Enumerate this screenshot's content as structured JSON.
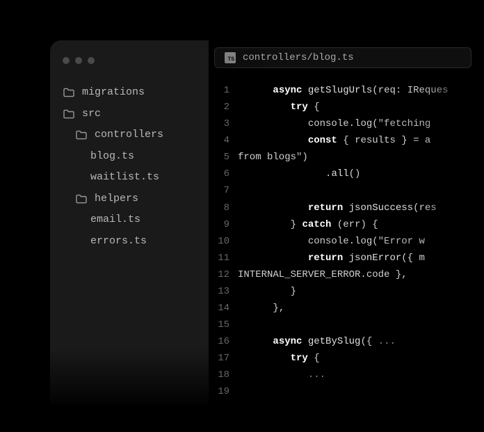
{
  "sidebar": {
    "items": [
      {
        "type": "folder",
        "label": "migrations",
        "indent": 0
      },
      {
        "type": "folder",
        "label": "src",
        "indent": 0
      },
      {
        "type": "folder",
        "label": "controllers",
        "indent": 1
      },
      {
        "type": "file",
        "label": "blog.ts",
        "indent": 2
      },
      {
        "type": "file",
        "label": "waitlist.ts",
        "indent": 2
      },
      {
        "type": "folder",
        "label": "helpers",
        "indent": 1
      },
      {
        "type": "file",
        "label": "email.ts",
        "indent": 2
      },
      {
        "type": "file",
        "label": "errors.ts",
        "indent": 2
      }
    ]
  },
  "tab": {
    "badge": "TS",
    "path": "controllers/blog.ts"
  },
  "code": {
    "line_start": 1,
    "line_end": 19,
    "lines": [
      {
        "n": 1,
        "tokens": [
          [
            "ind",
            "      "
          ],
          [
            "kw",
            "async"
          ],
          [
            "txt",
            " "
          ],
          [
            "fn",
            "getSlugUrls"
          ],
          [
            "punct",
            "("
          ],
          [
            "txt",
            "req"
          ],
          [
            "punct",
            ": "
          ],
          [
            "typ",
            "IReques"
          ]
        ]
      },
      {
        "n": 2,
        "tokens": [
          [
            "ind",
            "         "
          ],
          [
            "kw",
            "try"
          ],
          [
            "txt",
            " "
          ],
          [
            "punct",
            "{"
          ]
        ]
      },
      {
        "n": 3,
        "tokens": [
          [
            "ind",
            "            "
          ],
          [
            "txt",
            "console.log"
          ],
          [
            "punct",
            "("
          ],
          [
            "str",
            "\"fetching"
          ]
        ]
      },
      {
        "n": 4,
        "tokens": [
          [
            "ind",
            "            "
          ],
          [
            "kw",
            "const"
          ],
          [
            "txt",
            " "
          ],
          [
            "punct",
            "{ "
          ],
          [
            "txt",
            "results"
          ],
          [
            "punct",
            " } = "
          ],
          [
            "txt",
            "a"
          ]
        ]
      },
      {
        "n": 5,
        "tokens": [
          [
            "txt",
            "from blogs"
          ],
          [
            "str",
            "\""
          ],
          [
            "punct",
            ")"
          ]
        ]
      },
      {
        "n": 6,
        "tokens": [
          [
            "ind",
            "               "
          ],
          [
            "punct",
            "."
          ],
          [
            "fn",
            "all"
          ],
          [
            "punct",
            "()"
          ]
        ]
      },
      {
        "n": 7,
        "tokens": []
      },
      {
        "n": 8,
        "tokens": [
          [
            "ind",
            "            "
          ],
          [
            "kw",
            "return"
          ],
          [
            "txt",
            " "
          ],
          [
            "fn",
            "jsonSuccess"
          ],
          [
            "punct",
            "("
          ],
          [
            "txt",
            "res"
          ]
        ]
      },
      {
        "n": 9,
        "tokens": [
          [
            "ind",
            "         "
          ],
          [
            "punct",
            "} "
          ],
          [
            "kw",
            "catch"
          ],
          [
            "txt",
            " "
          ],
          [
            "punct",
            "("
          ],
          [
            "txt",
            "err"
          ],
          [
            "punct",
            ") {"
          ]
        ]
      },
      {
        "n": 10,
        "tokens": [
          [
            "ind",
            "            "
          ],
          [
            "txt",
            "console.log"
          ],
          [
            "punct",
            "("
          ],
          [
            "str",
            "\"Error w"
          ]
        ]
      },
      {
        "n": 11,
        "tokens": [
          [
            "ind",
            "            "
          ],
          [
            "kw",
            "return"
          ],
          [
            "txt",
            " "
          ],
          [
            "fn",
            "jsonError"
          ],
          [
            "punct",
            "({ "
          ],
          [
            "txt",
            "m"
          ]
        ]
      },
      {
        "n": 12,
        "tokens": [
          [
            "txt",
            "INTERNAL_SERVER_ERROR.code "
          ],
          [
            "punct",
            "}, "
          ]
        ]
      },
      {
        "n": 13,
        "tokens": [
          [
            "ind",
            "         "
          ],
          [
            "punct",
            "}"
          ]
        ]
      },
      {
        "n": 14,
        "tokens": [
          [
            "ind",
            "      "
          ],
          [
            "punct",
            "},"
          ]
        ]
      },
      {
        "n": 15,
        "tokens": []
      },
      {
        "n": 16,
        "tokens": [
          [
            "ind",
            "      "
          ],
          [
            "kw",
            "async"
          ],
          [
            "txt",
            " "
          ],
          [
            "fn",
            "getBySlug"
          ],
          [
            "punct",
            "({ "
          ],
          [
            "dim",
            "..."
          ]
        ]
      },
      {
        "n": 17,
        "tokens": [
          [
            "ind",
            "         "
          ],
          [
            "kw",
            "try"
          ],
          [
            "txt",
            " "
          ],
          [
            "punct",
            "{"
          ]
        ]
      },
      {
        "n": 18,
        "tokens": [
          [
            "dim",
            "            ..."
          ]
        ]
      },
      {
        "n": 19,
        "tokens": []
      }
    ]
  }
}
